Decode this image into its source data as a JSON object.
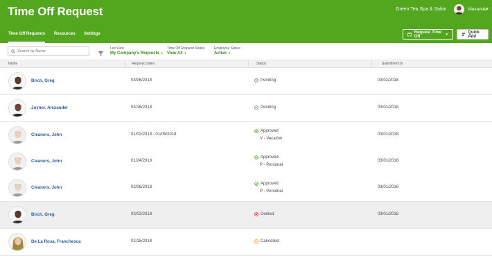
{
  "header": {
    "title": "Time Off Request",
    "company": "Green Tea Spa & Salon",
    "user_name": "Alexander"
  },
  "nav": {
    "tabs": [
      {
        "label": "Time Off Requests",
        "active": true
      },
      {
        "label": "Resources",
        "active": false
      },
      {
        "label": "Settings",
        "active": false
      }
    ]
  },
  "actions": {
    "request_time_off": "Request Time Off",
    "quick_add": "Quick Add"
  },
  "filters": {
    "search_placeholder": "Search by Name",
    "list_view_label": "List View",
    "list_view_value": "My Company's Requests",
    "request_status_label": "Time Off Request Status",
    "request_status_value": "View All",
    "employee_status_label": "Employee Status",
    "employee_status_value": "Active"
  },
  "table": {
    "columns": [
      "Name",
      "Request Dates",
      "Status",
      "Submitted On"
    ],
    "rows": [
      {
        "name": "Birch, Greg",
        "dates": "03/06/2018",
        "status": "Pending",
        "type": "",
        "submitted": "03/02/2018",
        "status_kind": "pending",
        "avatar": "man-dark"
      },
      {
        "name": "Joyner, Alexander",
        "dates": "03/15/2018",
        "status": "Pending",
        "type": "",
        "submitted": "03/01/2018",
        "status_kind": "pending",
        "avatar": "man-bald"
      },
      {
        "name": "Cleaners, John",
        "dates": "01/02/2018 - 01/05/2018",
        "status": "Approved",
        "type": "V - Vacation",
        "submitted": "03/01/2018",
        "status_kind": "approved",
        "avatar": "man-gray"
      },
      {
        "name": "Cleaners, John",
        "dates": "01/24/2018",
        "status": "Approved",
        "type": "P - Personal",
        "submitted": "03/01/2018",
        "status_kind": "approved",
        "avatar": "man-gray"
      },
      {
        "name": "Cleaners, John",
        "dates": "02/06/2018",
        "status": "Approved",
        "type": "P - Personal",
        "submitted": "03/01/2018",
        "status_kind": "approved",
        "avatar": "man-gray"
      },
      {
        "name": "Birch, Greg",
        "dates": "03/02/2018",
        "status": "Denied",
        "type": "",
        "submitted": "03/01/2018",
        "status_kind": "denied",
        "avatar": "man-dark"
      },
      {
        "name": "De La Rosa, Franchesca",
        "dates": "02/15/2018",
        "status": "Cancelled",
        "type": "",
        "submitted": "",
        "status_kind": "cancelled",
        "avatar": "woman"
      }
    ]
  },
  "colors": {
    "brand_green": "#53a71e",
    "link_blue": "#2c5b9b",
    "pending": "#5b7ea6",
    "approved": "#4caf2e",
    "denied": "#d9342b",
    "cancelled": "#f0932b"
  }
}
